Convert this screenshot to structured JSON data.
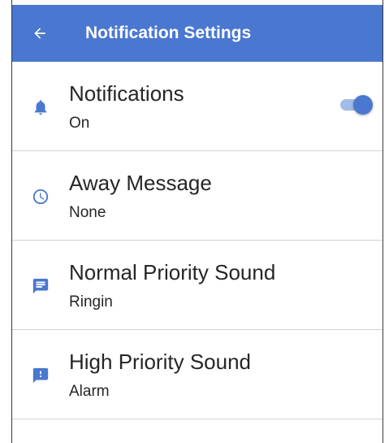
{
  "colors": {
    "app_bar": "#4a77cf",
    "accent": "#4a77cf",
    "toggle_track": "#a3bbe8",
    "divider": "#d2d2d2",
    "text": "#262626"
  },
  "app_bar": {
    "back_icon": "arrow-left-icon",
    "title": "Notification Settings"
  },
  "settings": [
    {
      "icon": "bell-icon",
      "title": "Notifications",
      "value": "On",
      "toggle_on": true
    },
    {
      "icon": "clock-icon",
      "title": "Away Message",
      "value": "None"
    },
    {
      "icon": "message-icon",
      "title": "Normal Priority Sound",
      "value": "Ringin"
    },
    {
      "icon": "priority-message-icon",
      "title": "High Priority Sound",
      "value": "Alarm"
    }
  ]
}
